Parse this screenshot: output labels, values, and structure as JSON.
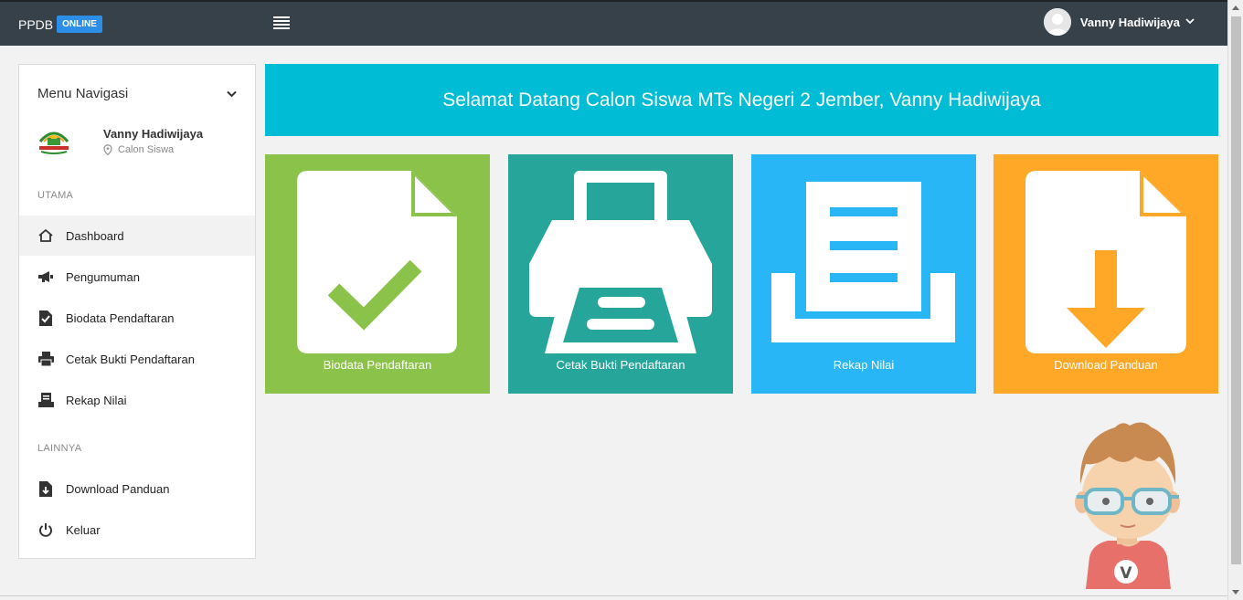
{
  "header": {
    "brand": "PPDB",
    "brand_badge": "ONLINE",
    "user_name": "Vanny Hadiwijaya",
    "colors": {
      "bar": "#374149",
      "badge": "#2d8ee8"
    }
  },
  "sidebar": {
    "title": "Menu Navigasi",
    "profile": {
      "name": "Vanny Hadiwijaya",
      "role": "Calon Siswa"
    },
    "sections": [
      {
        "label": "UTAMA",
        "items": [
          {
            "label": "Dashboard",
            "icon": "home-icon",
            "active": true
          },
          {
            "label": "Pengumuman",
            "icon": "megaphone-icon"
          },
          {
            "label": "Biodata Pendaftaran",
            "icon": "file-check-icon"
          },
          {
            "label": "Cetak Bukti Pendaftaran",
            "icon": "printer-icon"
          },
          {
            "label": "Rekap Nilai",
            "icon": "tray-list-icon"
          }
        ]
      },
      {
        "label": "LAINNYA",
        "items": [
          {
            "label": "Download Panduan",
            "icon": "file-download-icon"
          },
          {
            "label": "Keluar",
            "icon": "power-icon"
          }
        ]
      }
    ]
  },
  "main": {
    "welcome": "Selamat Datang Calon Siswa MTs Negeri 2 Jember, Vanny Hadiwijaya",
    "welcome_color": "#00bcd4",
    "tiles": [
      {
        "label": "Biodata Pendaftaran",
        "icon": "file-check-icon",
        "color": "#8bc34a"
      },
      {
        "label": "Cetak Bukti Pendaftaran",
        "icon": "printer-icon",
        "color": "#26a69a"
      },
      {
        "label": "Rekap Nilai",
        "icon": "tray-list-icon",
        "color": "#29b6f6"
      },
      {
        "label": "Download Panduan",
        "icon": "file-download-icon",
        "color": "#ffa726"
      }
    ]
  }
}
